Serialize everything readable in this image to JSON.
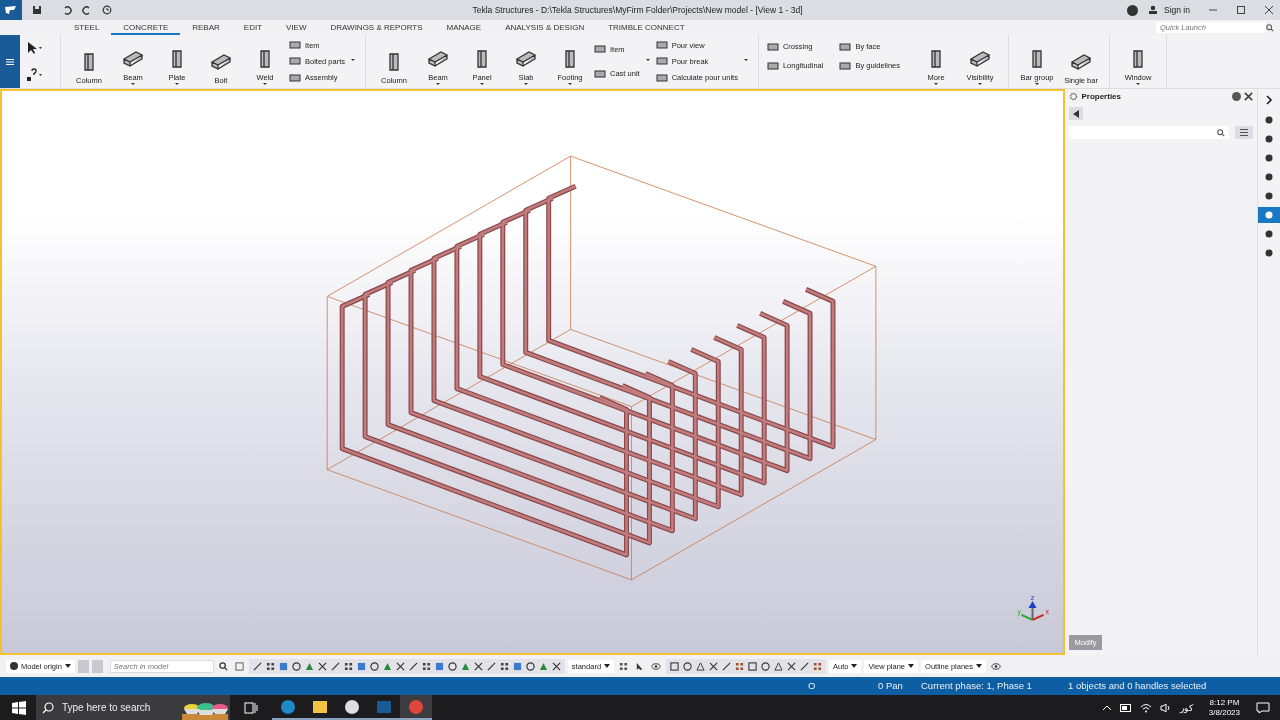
{
  "window": {
    "title": "Tekla Structures - D:\\Tekla Structures\\MyFirm Folder\\Projects\\New model  - [View 1 - 3d]",
    "sign_in": "Sign in"
  },
  "quick_launch": {
    "placeholder": "Quick Launch"
  },
  "tabs": [
    {
      "label": "STEEL",
      "selected": false
    },
    {
      "label": "CONCRETE",
      "selected": true
    },
    {
      "label": "REBAR",
      "selected": false
    },
    {
      "label": "EDIT",
      "selected": false
    },
    {
      "label": "VIEW",
      "selected": false
    },
    {
      "label": "DRAWINGS & REPORTS",
      "selected": false
    },
    {
      "label": "MANAGE",
      "selected": false
    },
    {
      "label": "ANALYSIS & DESIGN",
      "selected": false
    },
    {
      "label": "TRIMBLE CONNECT",
      "selected": false
    }
  ],
  "ribbon": [
    {
      "items": [
        {
          "kind": "large",
          "label": "Column",
          "dropdown": false
        },
        {
          "kind": "large",
          "label": "Beam",
          "dropdown": true
        },
        {
          "kind": "large",
          "label": "Plate",
          "dropdown": true
        },
        {
          "kind": "large",
          "label": "Bolt",
          "dropdown": false
        },
        {
          "kind": "large",
          "label": "Weld",
          "dropdown": true
        },
        {
          "kind": "stack",
          "dropdown": true,
          "entries": [
            "Item",
            "Bolted parts",
            "Assembly"
          ]
        }
      ]
    },
    {
      "items": [
        {
          "kind": "large",
          "label": "Column",
          "dropdown": false
        },
        {
          "kind": "large",
          "label": "Beam",
          "dropdown": true
        },
        {
          "kind": "large",
          "label": "Panel",
          "dropdown": true
        },
        {
          "kind": "large",
          "label": "Slab",
          "dropdown": true
        },
        {
          "kind": "large",
          "label": "Footing",
          "dropdown": true
        },
        {
          "kind": "stack",
          "dropdown": true,
          "entries": [
            "Item",
            "Cast unit"
          ]
        },
        {
          "kind": "stack",
          "dropdown": true,
          "entries": [
            "Pour view",
            "Pour break",
            "Calculate pour units"
          ]
        }
      ]
    },
    {
      "items": [
        {
          "kind": "stack",
          "dropdown": false,
          "entries": [
            "Crossing",
            "Longitudinal"
          ]
        },
        {
          "kind": "stack",
          "dropdown": false,
          "entries": [
            "By face",
            "By guidelines"
          ]
        },
        {
          "kind": "large",
          "label": "More",
          "dropdown": true
        },
        {
          "kind": "large",
          "label": "Visibility",
          "dropdown": true
        }
      ]
    },
    {
      "items": [
        {
          "kind": "large",
          "label": "Bar group",
          "dropdown": true
        },
        {
          "kind": "large",
          "label": "Single bar",
          "dropdown": false
        }
      ]
    },
    {
      "items": [
        {
          "kind": "large",
          "label": "Window",
          "dropdown": true
        }
      ]
    }
  ],
  "viewport": {
    "axis_labels": [
      "z",
      "y",
      "x"
    ]
  },
  "properties": {
    "title": "Properties",
    "button": "Modify",
    "button_disabled": true
  },
  "side_tools": [
    {
      "selected": false
    },
    {
      "selected": false
    },
    {
      "selected": false
    },
    {
      "selected": false
    },
    {
      "selected": false
    },
    {
      "selected": true
    },
    {
      "selected": false
    },
    {
      "selected": false
    }
  ],
  "bottom_toolbar": {
    "origin": "Model origin",
    "search_placeholder": "Search in model",
    "dropdowns": [
      "standard",
      "Auto",
      "View plane",
      "Outline planes"
    ]
  },
  "status_bar": [
    "O",
    "0 Pan",
    "Current phase: 1, Phase 1",
    "1 objects and 0 handles selected"
  ],
  "taskbar": {
    "search_placeholder": "Type here to search",
    "apps": [
      {
        "selected": false
      },
      {
        "selected": false
      },
      {
        "selected": false
      },
      {
        "selected": false
      },
      {
        "selected": true
      }
    ],
    "language": "کور",
    "time": "8:12 PM",
    "date": "3/8/2023"
  }
}
